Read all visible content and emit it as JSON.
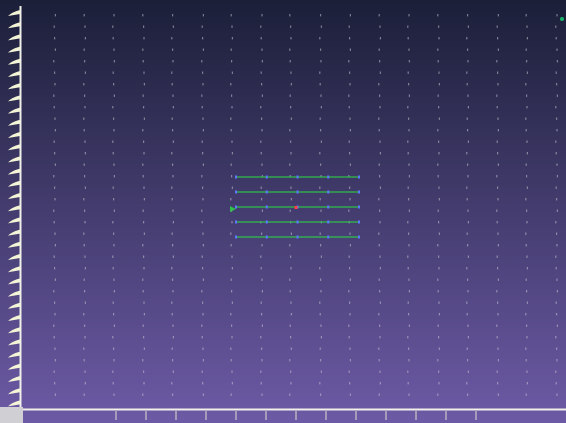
{
  "viewport": {
    "background_top": "#1b1f38",
    "background_bottom": "#6d5aa6",
    "grid_point_color": "#c8c8d4",
    "ruler_color": "#f0f0ea",
    "ruler_tick_color": "#f4f4d6",
    "selection_line_color": "#2fbf4a",
    "selection_point_color": "#5b7bff",
    "selection_center_color": "#ff4040",
    "corner_marker_color": "#19b26a"
  },
  "selection": {
    "rows": 5,
    "columns": 5
  }
}
